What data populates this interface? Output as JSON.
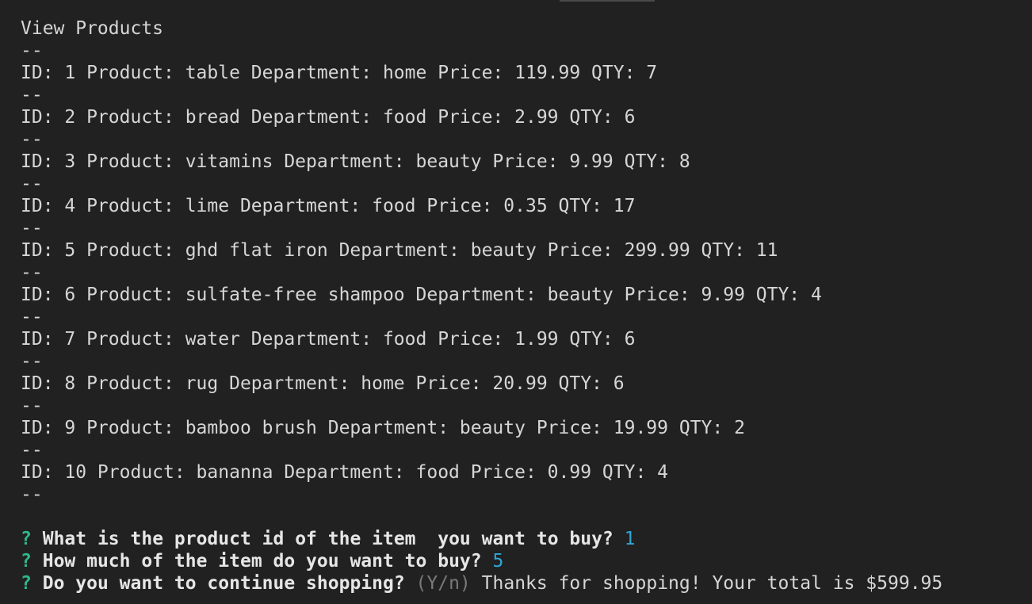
{
  "terminal": {
    "header": "View Products",
    "separator": "--",
    "products": [
      "ID: 1 Product: table Department: home Price: 119.99 QTY: 7",
      "ID: 2 Product: bread Department: food Price: 2.99 QTY: 6",
      "ID: 3 Product: vitamins Department: beauty Price: 9.99 QTY: 8",
      "ID: 4 Product: lime Department: food Price: 0.35 QTY: 17",
      "ID: 5 Product: ghd flat iron Department: beauty Price: 299.99 QTY: 11",
      "ID: 6 Product: sulfate-free shampoo Department: beauty Price: 9.99 QTY: 4",
      "ID: 7 Product: water Department: food Price: 1.99 QTY: 6",
      "ID: 8 Product: rug Department: home Price: 20.99 QTY: 6",
      "ID: 9 Product: bamboo brush Department: beauty Price: 19.99 QTY: 2",
      "ID: 10 Product: bananna Department: food Price: 0.99 QTY: 4"
    ],
    "prompts": [
      {
        "mark": "?",
        "question": "What is the product id of the item  you want to buy?",
        "answer": "1"
      },
      {
        "mark": "?",
        "question": "How much of the item do you want to buy?",
        "answer": "5"
      },
      {
        "mark": "?",
        "question": "Do you want to continue shopping?",
        "hint": "(Y/n)",
        "output": "Thanks for shopping! Your total is $599.95"
      }
    ]
  }
}
